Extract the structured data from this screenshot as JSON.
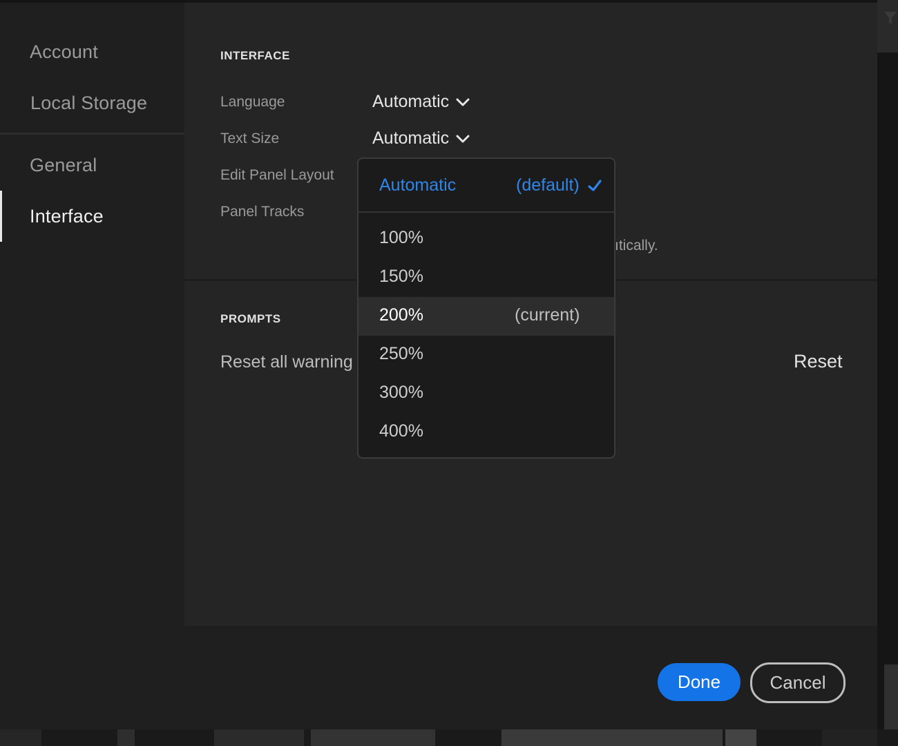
{
  "sidebar": {
    "items": [
      {
        "label": "Account"
      },
      {
        "label": "Local Storage"
      },
      {
        "label": "General"
      },
      {
        "label": "Interface",
        "active": true
      }
    ]
  },
  "interface_section": {
    "heading": "INTERFACE",
    "language_label": "Language",
    "language_value": "Automatic",
    "text_size_label": "Text Size",
    "text_size_value": "Automatic",
    "edit_panel_layout_label": "Edit Panel Layout",
    "panel_tracks_label": "Panel Tracks",
    "partial_hidden_text": "ıtically."
  },
  "prompts_section": {
    "heading": "PROMPTS",
    "reset_warnings_label": "Reset all warning",
    "reset_button": "Reset"
  },
  "text_size_menu": {
    "header": {
      "label": "Automatic",
      "note": "(default)",
      "icon": "checkmark-icon"
    },
    "options": [
      {
        "label": "100%",
        "note": ""
      },
      {
        "label": "150%",
        "note": ""
      },
      {
        "label": "200%",
        "note": "(current)",
        "highlighted": true
      },
      {
        "label": "250%",
        "note": ""
      },
      {
        "label": "300%",
        "note": ""
      },
      {
        "label": "400%",
        "note": ""
      }
    ]
  },
  "footer": {
    "done_label": "Done",
    "cancel_label": "Cancel"
  },
  "colors": {
    "accent_blue": "#1473e6",
    "selected_blue_text": "#2f86ea",
    "dialog_bg": "#1f1f1f",
    "content_bg": "#252525",
    "menu_bg": "#1b1b1b"
  }
}
